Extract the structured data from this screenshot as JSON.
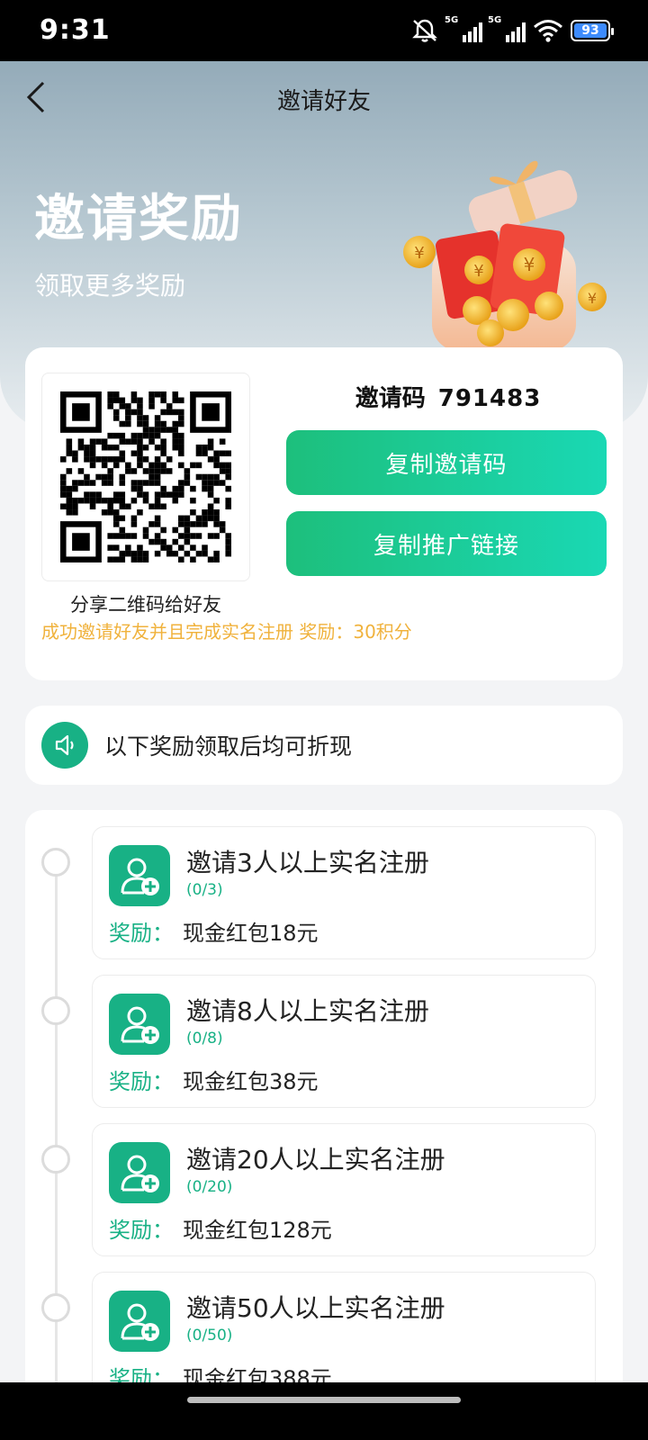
{
  "status_bar": {
    "time": "9:31",
    "net1": "5G",
    "net2": "5G",
    "battery": "93",
    "icons": [
      "mute-icon",
      "signal-icon",
      "signal-icon",
      "wifi-icon",
      "battery-icon"
    ]
  },
  "nav": {
    "title": "邀请好友",
    "back_icon": "chevron-left-icon"
  },
  "hero": {
    "title": "邀请奖励",
    "subtitle": "领取更多奖励"
  },
  "invite": {
    "code_label": "邀请码",
    "code_value": "791483",
    "copy_code_label": "复制邀请码",
    "copy_link_label": "复制推广链接",
    "qr_caption": "分享二维码给好友",
    "reward_note": "成功邀请好友并且完成实名注册 奖励：30积分"
  },
  "notice": {
    "icon": "speaker-icon",
    "text": "以下奖励领取后均可折现"
  },
  "tasks": [
    {
      "title": "邀请3人以上实名注册",
      "progress": "(0/3)",
      "reward_label": "奖励：",
      "reward_value": "现金红包18元"
    },
    {
      "title": "邀请8人以上实名注册",
      "progress": "(0/8)",
      "reward_label": "奖励：",
      "reward_value": "现金红包38元"
    },
    {
      "title": "邀请20人以上实名注册",
      "progress": "(0/20)",
      "reward_label": "奖励：",
      "reward_value": "现金红包128元"
    },
    {
      "title": "邀请50人以上实名注册",
      "progress": "(0/50)",
      "reward_label": "奖励：",
      "reward_value": "现金红包388元"
    }
  ],
  "colors": {
    "accent_green": "#18b185",
    "button_gradient_start": "#1dbf7c",
    "button_gradient_end": "#1ad8b4",
    "note_orange": "#f0b23c",
    "hero_top": "#94abb9"
  }
}
